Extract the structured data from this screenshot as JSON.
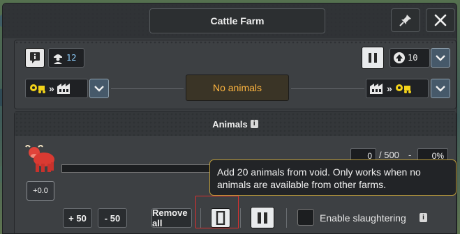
{
  "window": {
    "title": "Cattle Farm"
  },
  "top_row": {
    "workers": "12",
    "priority": "10"
  },
  "status": {
    "text": "No animals"
  },
  "animals": {
    "header": "Animals",
    "count": "0",
    "capacity": "/ 500",
    "dash": "-",
    "percent": "0%",
    "rate": "+0.0",
    "progress_fraction": 0.0,
    "buttons": {
      "add": "+ 50",
      "remove": "- 50",
      "remove_all": "Remove all"
    },
    "slaughter_label": "Enable slaughtering"
  },
  "tooltip": {
    "text": "Add 20 animals from void. Only works when no animals are available from other farms."
  },
  "colors": {
    "accent_yellow": "#f2d21a",
    "status_orange": "#ffb640",
    "tooltip_border": "#b99a3a",
    "highlight_red": "#d93030",
    "chevron_bg": "#46596a"
  },
  "icons": [
    "info-icon",
    "worker-icon",
    "pin-icon",
    "close-icon",
    "pause-icon",
    "up-arrow-icon",
    "chevron-down-icon",
    "gear-truck-icon",
    "factory-icon",
    "cow-icon"
  ]
}
